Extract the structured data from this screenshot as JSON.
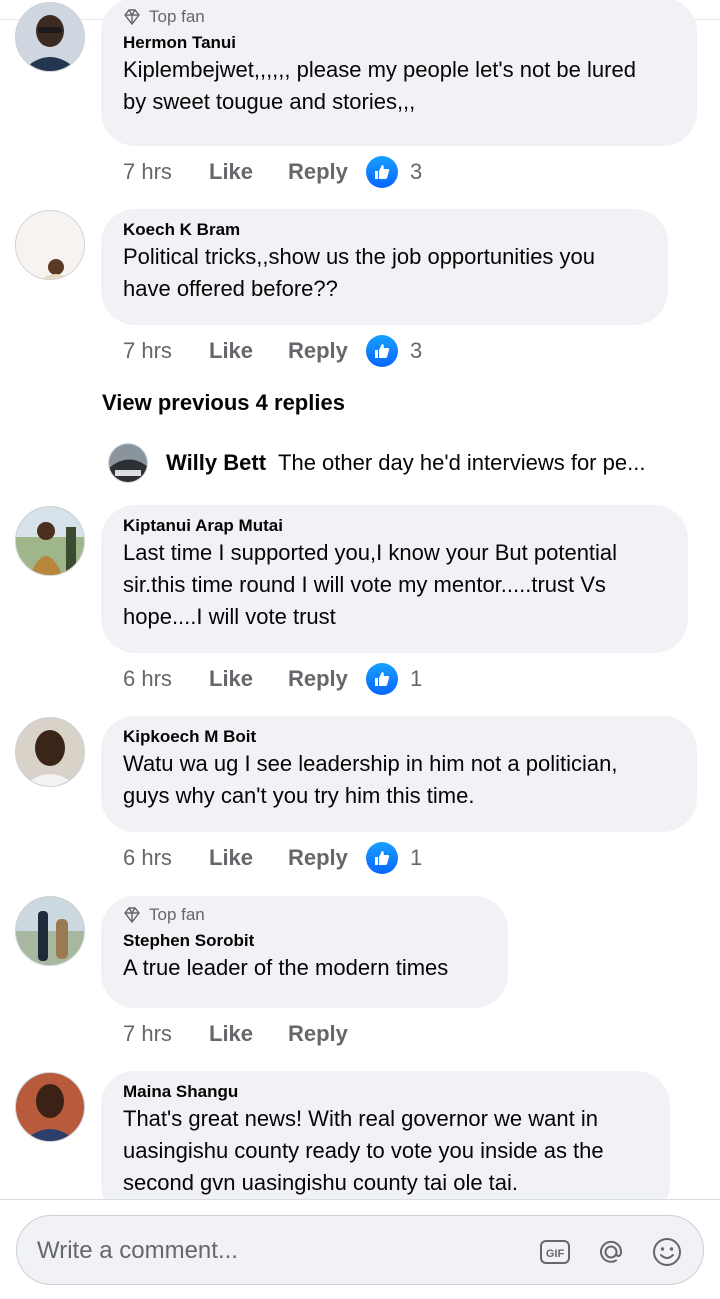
{
  "comments": [
    {
      "top_fan": "Top fan",
      "author": "Hermon Tanui",
      "lines": [
        "Kiplembejwet,,,,,, please my people let's not be lured",
        "by sweet tougue and stories,,,"
      ],
      "time": "7 hrs",
      "like": "Like",
      "reply": "Reply",
      "reactions": "3"
    },
    {
      "author": "Koech K Bram",
      "lines": [
        "Political tricks,,show us the job opportunities you",
        "have offered before??"
      ],
      "time": "7 hrs",
      "like": "Like",
      "reply": "Reply",
      "reactions": "3"
    },
    {
      "author": "Kiptanui Arap Mutai",
      "lines": [
        "Last time I supported you,I know your But potential",
        "sir.this time round I will vote my mentor.....trust Vs",
        "hope....I will vote trust"
      ],
      "time": "6 hrs",
      "like": "Like",
      "reply": "Reply",
      "reactions": "1"
    },
    {
      "author": "Kipkoech M Boit",
      "lines": [
        "Watu  wa ug  I see leadership in him not a politician,",
        "guys why can't you try him this time."
      ],
      "time": "6 hrs",
      "like": "Like",
      "reply": "Reply",
      "reactions": "1"
    },
    {
      "top_fan": "Top fan",
      "author": "Stephen Sorobit",
      "lines": [
        "A true leader of the modern times"
      ],
      "time": "7 hrs",
      "like": "Like",
      "reply": "Reply"
    },
    {
      "author": "Maina Shangu",
      "lines": [
        "That's great news! With real governor we want in",
        "uasingishu county ready to vote you inside as the",
        "second gvn uasingishu county tai ole tai."
      ]
    }
  ],
  "view_previous": "View previous 4 replies",
  "reply_preview": {
    "name": "Willy Bett",
    "snippet": "The other day he'd interviews for pe..."
  },
  "composer": {
    "placeholder": "Write a comment..."
  },
  "colors": {
    "bubble": "#f0f2f5",
    "like_blue": "#1877f2",
    "secondary_text": "#65676b"
  },
  "icons": [
    "diamond-icon",
    "thumbs-up-icon",
    "gif-icon",
    "mention-icon",
    "emoji-icon"
  ]
}
